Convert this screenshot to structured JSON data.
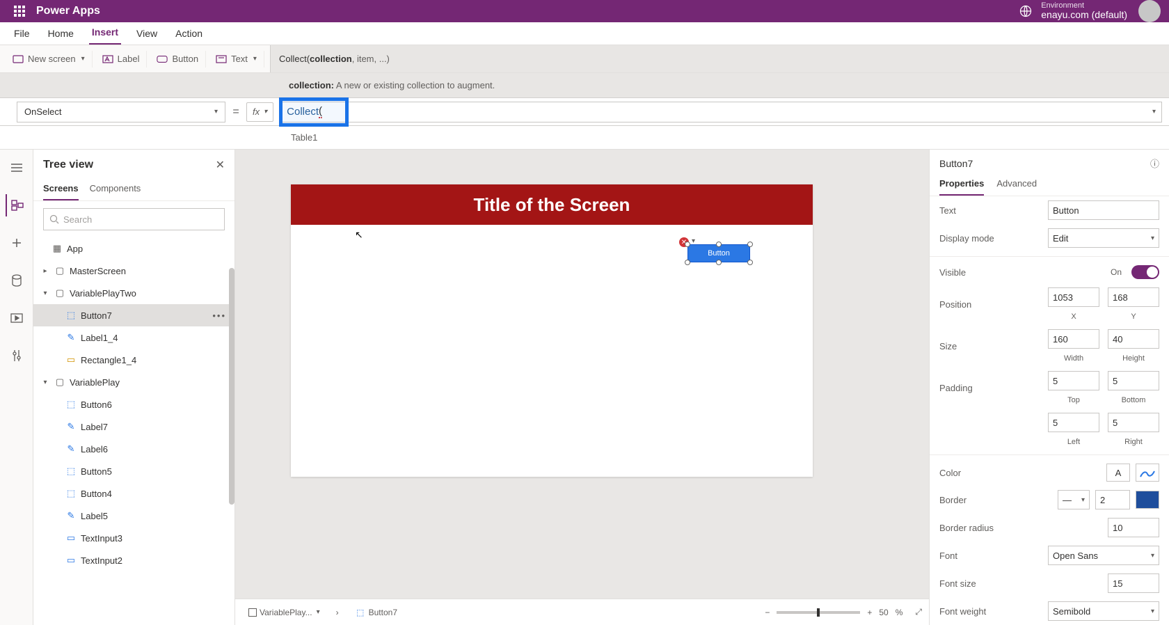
{
  "titlebar": {
    "app": "Power Apps",
    "env_label": "Environment",
    "env_name": "enayu.com (default)"
  },
  "menu": {
    "items": [
      "File",
      "Home",
      "Insert",
      "View",
      "Action"
    ],
    "active": "Insert"
  },
  "ribbon": {
    "new_screen": "New screen",
    "label_btn": "Label",
    "button_btn": "Button",
    "text_btn": "Text"
  },
  "signature": {
    "fn": "Collect(",
    "arg1": "collection",
    "rest": ", item, ...)"
  },
  "hint": {
    "label": "collection:",
    "desc": "A new or existing collection to augment."
  },
  "formula": {
    "property": "OnSelect",
    "fx": "fx",
    "expr_fn": "Collect",
    "expr_rest": "(",
    "suggestion": "Table1"
  },
  "tree": {
    "title": "Tree view",
    "tabs": {
      "screens": "Screens",
      "components": "Components"
    },
    "search_placeholder": "Search",
    "nodes": {
      "app": "App",
      "master": "MasterScreen",
      "vp2": "VariablePlayTwo",
      "button7": "Button7",
      "label1_4": "Label1_4",
      "rect1_4": "Rectangle1_4",
      "vp": "VariablePlay",
      "button6": "Button6",
      "label7": "Label7",
      "label6": "Label6",
      "button5": "Button5",
      "button4": "Button4",
      "label5": "Label5",
      "textinput3": "TextInput3",
      "textinput2": "TextInput2"
    }
  },
  "canvas": {
    "screen_title": "Title of the Screen",
    "button_text": "Button",
    "breadcrumb_screen": "VariablePlay...",
    "breadcrumb_control": "Button7",
    "zoom_value": "50",
    "zoom_pct": "%"
  },
  "props": {
    "selected": "Button7",
    "tabs": {
      "properties": "Properties",
      "advanced": "Advanced"
    },
    "labels": {
      "text": "Text",
      "display_mode": "Display mode",
      "visible": "Visible",
      "position": "Position",
      "size": "Size",
      "padding": "Padding",
      "color": "Color",
      "border": "Border",
      "border_radius": "Border radius",
      "font": "Font",
      "font_size": "Font size",
      "font_weight": "Font weight"
    },
    "values": {
      "text": "Button",
      "display_mode": "Edit",
      "visible": "On",
      "pos_x": "1053",
      "pos_y": "168",
      "size_w": "160",
      "size_h": "40",
      "pad_t": "5",
      "pad_b": "5",
      "pad_l": "5",
      "pad_r": "5",
      "border_w": "2",
      "border_radius": "10",
      "font": "Open Sans",
      "font_size": "15",
      "font_weight": "Semibold"
    },
    "sub": {
      "x": "X",
      "y": "Y",
      "w": "Width",
      "h": "Height",
      "t": "Top",
      "b": "Bottom",
      "l": "Left",
      "r": "Right"
    },
    "color_glyph": "A"
  }
}
